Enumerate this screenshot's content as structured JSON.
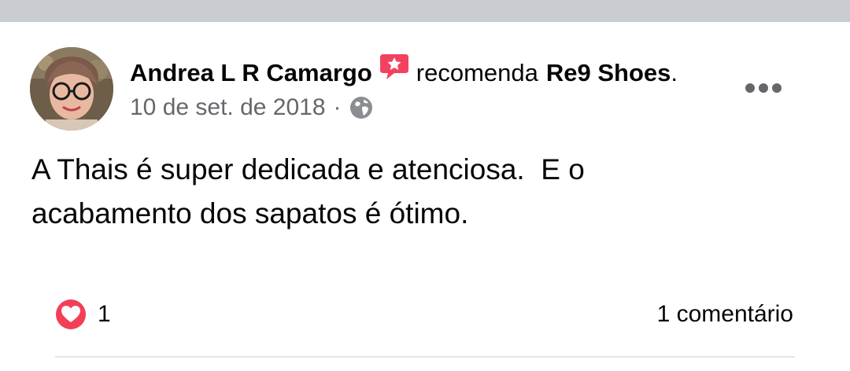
{
  "post": {
    "author": "Andrea L R Camargo",
    "verb": "recomenda",
    "page": "Re9 Shoes",
    "page_suffix": ".",
    "date": "10 de set. de 2018",
    "separator": "·",
    "audience_icon": "globe-icon",
    "recommend_icon": "recommend-star-icon",
    "body": "A Thais é super dedicada e atenciosa.  E o\nacabamento dos sapatos é ótimo.",
    "reactions": {
      "icon": "heart-icon",
      "count": "1"
    },
    "comments_label": "1 comentário"
  },
  "colors": {
    "divider": "#c9ccd1",
    "secondary_text": "#65676b",
    "recommend_red": "#f3425f",
    "heart_red": "#f33e58"
  }
}
